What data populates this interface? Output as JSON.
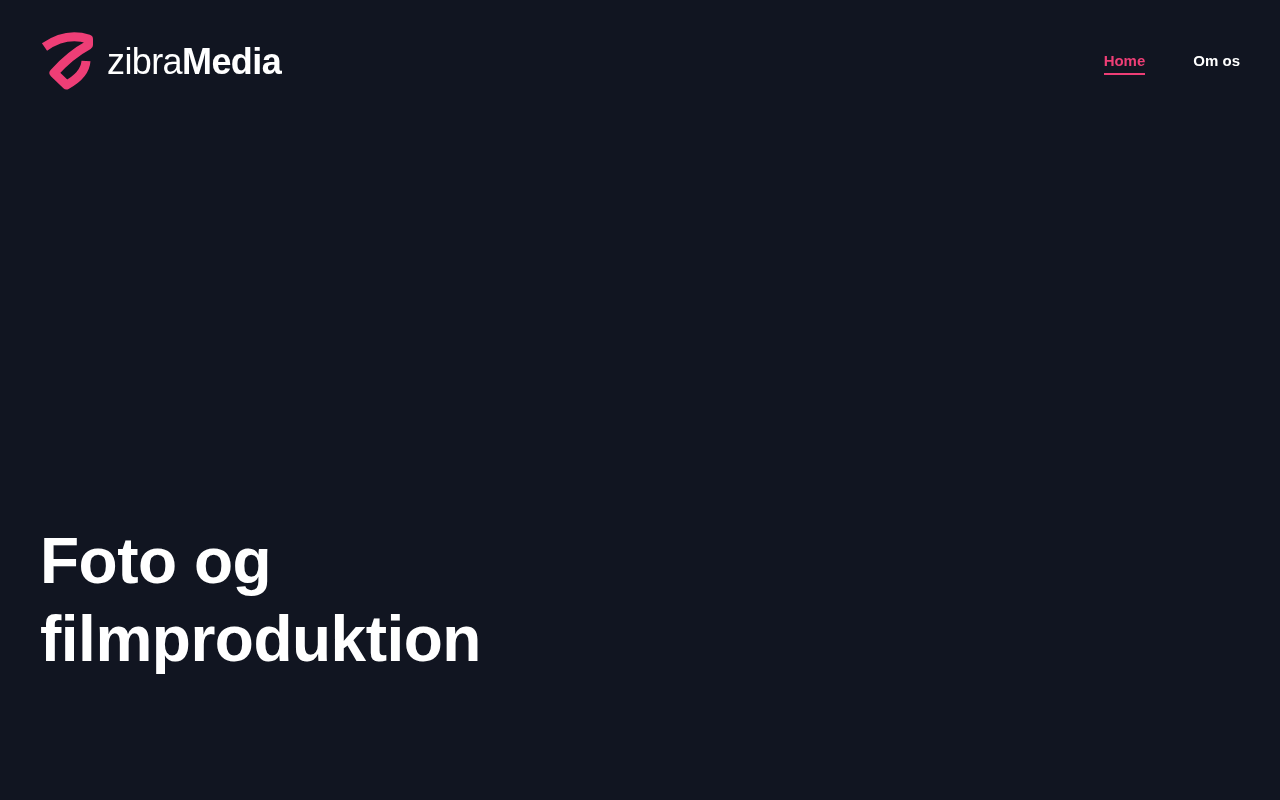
{
  "header": {
    "logo": {
      "text": "zibra**Media**"
    },
    "nav": [
      {
        "label": "Home",
        "selected": true
      },
      {
        "label": "Om os",
        "selected": false
      }
    ]
  },
  "hero": {
    "title": "Foto og filmproduktion"
  }
}
